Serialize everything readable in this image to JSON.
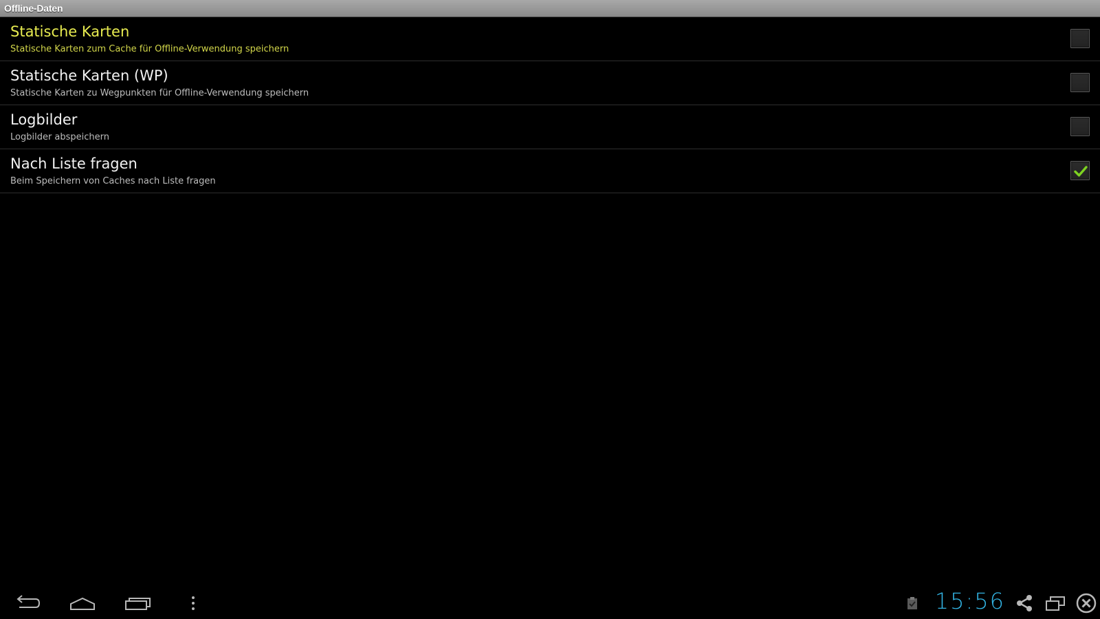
{
  "window": {
    "title": "Offline-Daten"
  },
  "preferences": [
    {
      "title": "Statische Karten",
      "summary": "Statische Karten zum Cache für Offline-Verwendung speichern",
      "checked": false,
      "highlighted": true
    },
    {
      "title": "Statische Karten (WP)",
      "summary": "Statische Karten zu Wegpunkten für Offline-Verwendung speichern",
      "checked": false,
      "highlighted": false
    },
    {
      "title": "Logbilder",
      "summary": "Logbilder abspeichern",
      "checked": false,
      "highlighted": false
    },
    {
      "title": "Nach Liste fragen",
      "summary": "Beim Speichern von Caches nach Liste fragen",
      "checked": true,
      "highlighted": false
    }
  ],
  "navigation": {
    "buttons": [
      "back-icon",
      "home-icon",
      "recent-apps-icon",
      "menu-overflow-icon"
    ]
  },
  "status": {
    "clock": "15:56",
    "icons": [
      "clipboard-check-icon",
      "share-icon",
      "window-resize-icon",
      "close-circle-icon"
    ]
  },
  "colors": {
    "highlight_title": "#e8ec50",
    "highlight_summary": "#d2d64a",
    "clock": "#33b5e5",
    "checkmark": "#7ed321"
  }
}
